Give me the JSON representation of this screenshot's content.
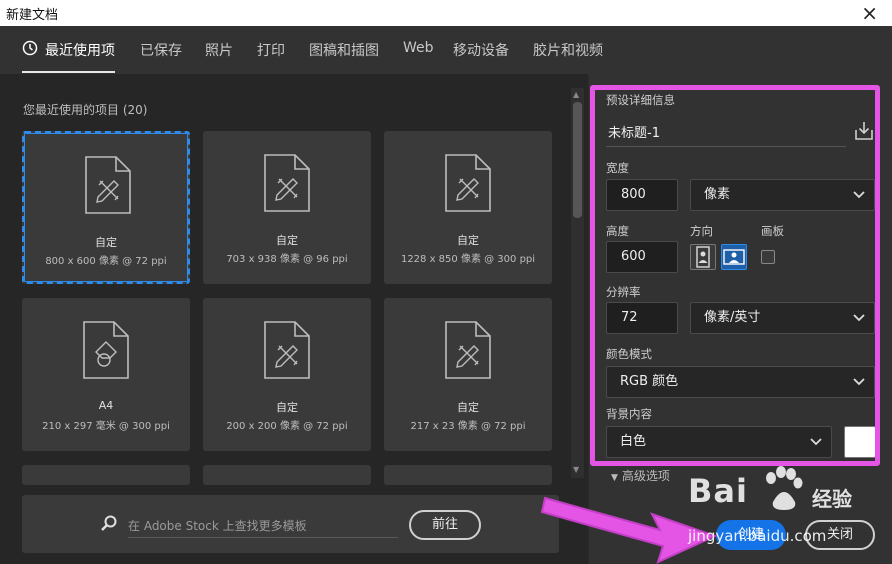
{
  "window": {
    "title": "新建文档",
    "close_glyph": "×"
  },
  "tabs": [
    {
      "label": "最近使用项",
      "icon": "clock-icon",
      "active": true
    },
    {
      "label": "已保存"
    },
    {
      "label": "照片"
    },
    {
      "label": "打印"
    },
    {
      "label": "图稿和插图"
    },
    {
      "label": "Web"
    },
    {
      "label": "移动设备"
    },
    {
      "label": "胶片和视频"
    }
  ],
  "recent": {
    "title": "您最近使用的项目 (20)",
    "items": [
      {
        "name": "自定",
        "spec": "800 x 600 像素 @ 72 ppi",
        "icon": "custom-doc-icon"
      },
      {
        "name": "自定",
        "spec": "703 x 938 像素 @ 96 ppi",
        "icon": "custom-doc-icon"
      },
      {
        "name": "自定",
        "spec": "1228 x 850 像素 @ 300 ppi",
        "icon": "custom-doc-icon"
      },
      {
        "name": "A4",
        "spec": "210 x 297 毫米 @ 300 ppi",
        "icon": "print-doc-icon"
      },
      {
        "name": "自定",
        "spec": "200 x 200 像素 @ 72 ppi",
        "icon": "custom-doc-icon"
      },
      {
        "name": "自定",
        "spec": "217 x 23 像素 @ 72 ppi",
        "icon": "custom-doc-icon"
      }
    ]
  },
  "search": {
    "placeholder": "在 Adobe Stock 上查找更多模板",
    "go_label": "前往"
  },
  "details": {
    "header": "预设详细信息",
    "doc_name": "未标题-1",
    "width_label": "宽度",
    "width_value": "800",
    "width_unit": "像素",
    "height_label": "高度",
    "height_value": "600",
    "orientation_label": "方向",
    "artboard_label": "画板",
    "resolution_label": "分辨率",
    "resolution_value": "72",
    "resolution_unit": "像素/英寸",
    "color_mode_label": "颜色模式",
    "color_mode_value": "RGB 颜色",
    "background_label": "背景内容",
    "background_value": "白色",
    "background_color": "#ffffff",
    "advanced_label": "高级选项"
  },
  "actions": {
    "create_label": "创建",
    "close_label": "关闭"
  },
  "watermark": {
    "brand": "Bai",
    "brand_suffix": "经验",
    "url": "jingyan.baidu.com"
  },
  "colors": {
    "accent": "#1473e6",
    "highlight": "#e455e6",
    "selection": "#2d8ceb"
  }
}
